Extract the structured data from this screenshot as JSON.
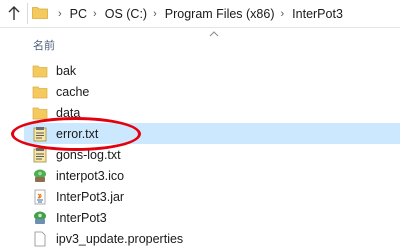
{
  "address_bar": {
    "crumbs": [
      "PC",
      "OS (C:)",
      "Program Files (x86)",
      "InterPot3"
    ],
    "up_icon": "up-arrow-icon",
    "folder_icon": "folder-icon"
  },
  "header": {
    "name_column": "名前"
  },
  "files": [
    {
      "name": "bak",
      "icon": "folder-icon",
      "selected": false
    },
    {
      "name": "cache",
      "icon": "folder-icon",
      "selected": false
    },
    {
      "name": "data",
      "icon": "folder-icon",
      "selected": false
    },
    {
      "name": "error.txt",
      "icon": "text-file-icon",
      "selected": true
    },
    {
      "name": "gons-log.txt",
      "icon": "text-file-icon",
      "selected": false
    },
    {
      "name": "interpot3.ico",
      "icon": "ico-file-icon",
      "selected": false
    },
    {
      "name": "InterPot3.jar",
      "icon": "jar-file-icon",
      "selected": false
    },
    {
      "name": "InterPot3",
      "icon": "app-icon",
      "selected": false
    },
    {
      "name": "ipv3_update.properties",
      "icon": "properties-file-icon",
      "selected": false
    }
  ],
  "colors": {
    "selection": "#cce8ff",
    "highlight": "#e3000f",
    "folder": "#f4c95d"
  }
}
